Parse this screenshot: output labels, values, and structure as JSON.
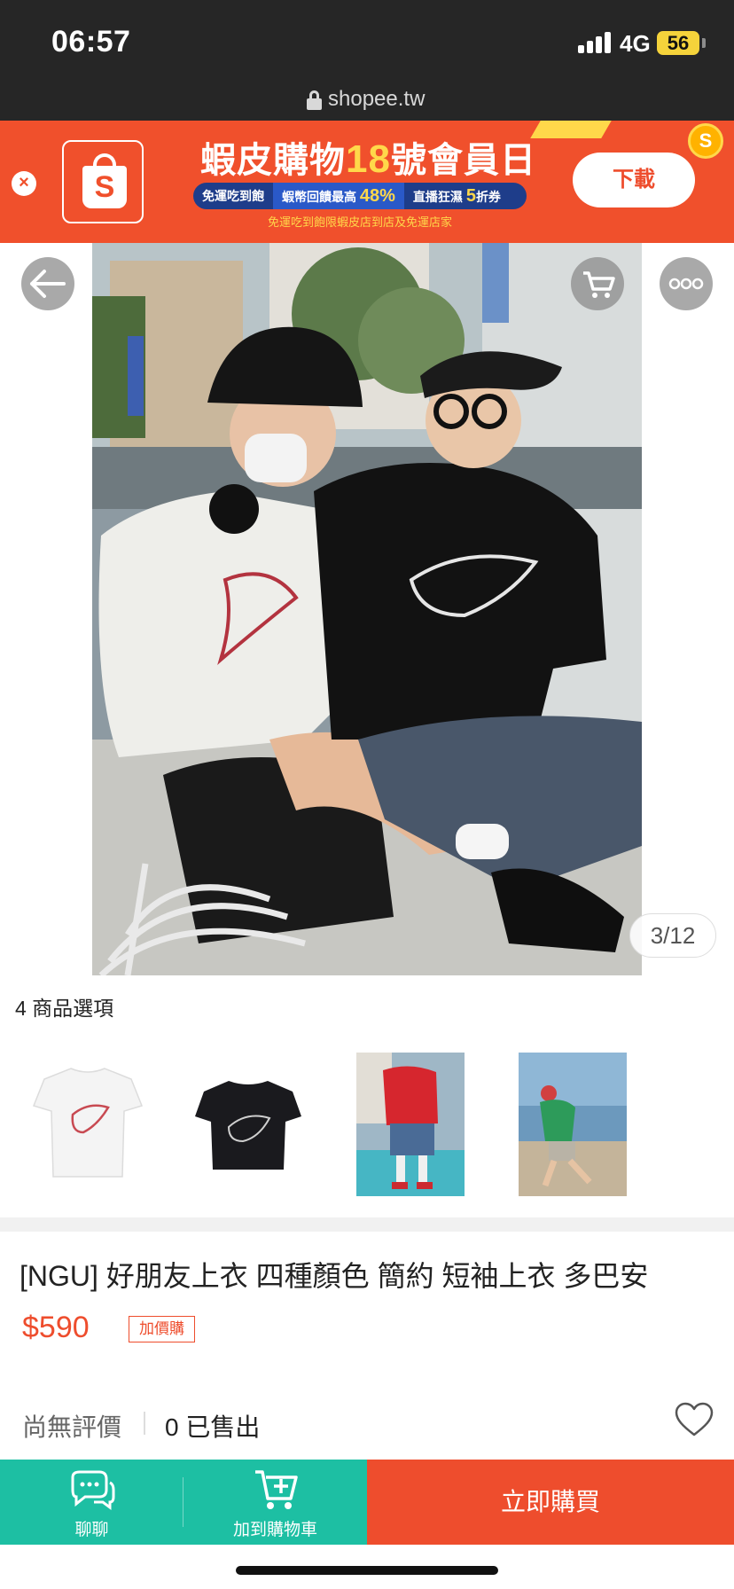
{
  "status_bar": {
    "time": "06:57",
    "network": "4G",
    "battery": "56"
  },
  "browser": {
    "url": "shopee.tw"
  },
  "app_banner": {
    "headline_prefix": "蝦皮購物",
    "headline_number": "18",
    "headline_suffix": "號會員日",
    "perk_1": "免運吃到飽",
    "perk_2_text": "蝦幣回饋最高",
    "perk_2_value": "48%",
    "perk_3_text": "直播狂濕",
    "perk_3_value": "5",
    "perk_3_suffix": "折券",
    "subline": "免運吃到飽限蝦皮店到店及免運店家",
    "download_label": "下載",
    "close_glyph": "×",
    "coin_glyph": "S",
    "logo_glyph": "S"
  },
  "gallery": {
    "counter": "3/12"
  },
  "variations": {
    "label": "4 商品選項",
    "count": 4
  },
  "product": {
    "title": "[NGU] 好朋友上衣 四種顏色 簡約 短袖上衣 多巴安",
    "price": "$590",
    "tag": "加價購",
    "rating": "尚無評價",
    "sold": "0 已售出"
  },
  "bottom_bar": {
    "chat_label": "聊聊",
    "add_to_cart_label": "加到購物車",
    "buy_now_label": "立即購買"
  },
  "colors": {
    "brand": "#ee4d2d",
    "banner": "#f0502c",
    "teal": "#1dbfa3",
    "status_bg": "#262626"
  },
  "icons": {
    "back": "arrow-left-icon",
    "cart": "cart-icon",
    "more": "more-icon",
    "heart": "heart-icon",
    "chat": "chat-bubbles-icon",
    "add_cart": "cart-plus-icon",
    "lock": "lock-icon"
  }
}
